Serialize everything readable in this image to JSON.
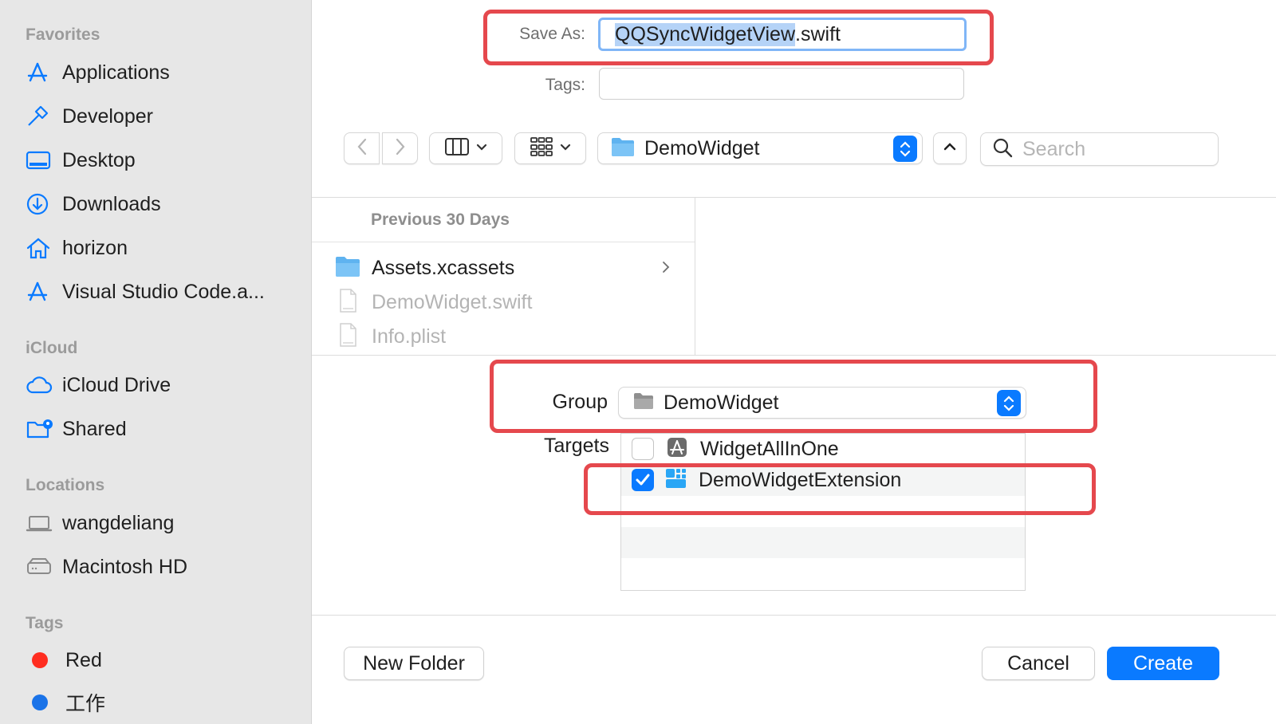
{
  "sidebar": {
    "favorites_header": "Favorites",
    "favorites": [
      {
        "label": "Applications",
        "icon": "applications-icon"
      },
      {
        "label": "Developer",
        "icon": "hammer-icon"
      },
      {
        "label": "Desktop",
        "icon": "desktop-icon"
      },
      {
        "label": "Downloads",
        "icon": "downloads-icon"
      },
      {
        "label": "horizon",
        "icon": "home-icon"
      },
      {
        "label": "Visual Studio Code.a...",
        "icon": "applications-icon"
      }
    ],
    "icloud_header": "iCloud",
    "icloud": [
      {
        "label": "iCloud Drive",
        "icon": "cloud-icon"
      },
      {
        "label": "Shared",
        "icon": "shared-folder-icon"
      }
    ],
    "locations_header": "Locations",
    "locations": [
      {
        "label": "wangdeliang",
        "icon": "laptop-icon"
      },
      {
        "label": "Macintosh HD",
        "icon": "disk-icon"
      }
    ],
    "tags_header": "Tags",
    "tags": [
      {
        "label": "Red",
        "color": "#ff2d20"
      },
      {
        "label": "工作",
        "color": "#1a73e8"
      }
    ]
  },
  "save_form": {
    "save_as_label": "Save As:",
    "filename_selected": "QQSyncWidgetView",
    "filename_ext": ".swift",
    "tags_label": "Tags:",
    "tags_value": ""
  },
  "toolbar": {
    "location_name": "DemoWidget",
    "search_placeholder": "Search"
  },
  "browser": {
    "section_header": "Previous 30 Days",
    "files": [
      {
        "name": "Assets.xcassets",
        "type": "folder",
        "enabled": true
      },
      {
        "name": "DemoWidget.swift",
        "type": "swift-file",
        "enabled": false
      },
      {
        "name": "Info.plist",
        "type": "plist-file",
        "enabled": false
      }
    ]
  },
  "options": {
    "group_label": "Group",
    "group_value": "DemoWidget",
    "targets_label": "Targets",
    "targets": [
      {
        "name": "WidgetAllInOne",
        "checked": false
      },
      {
        "name": "DemoWidgetExtension",
        "checked": true
      }
    ]
  },
  "buttons": {
    "new_folder": "New Folder",
    "cancel": "Cancel",
    "create": "Create"
  },
  "colors": {
    "accent": "#0a7aff",
    "highlight_box": "#e5484d",
    "sidebar_bg": "#e7e7e7"
  }
}
